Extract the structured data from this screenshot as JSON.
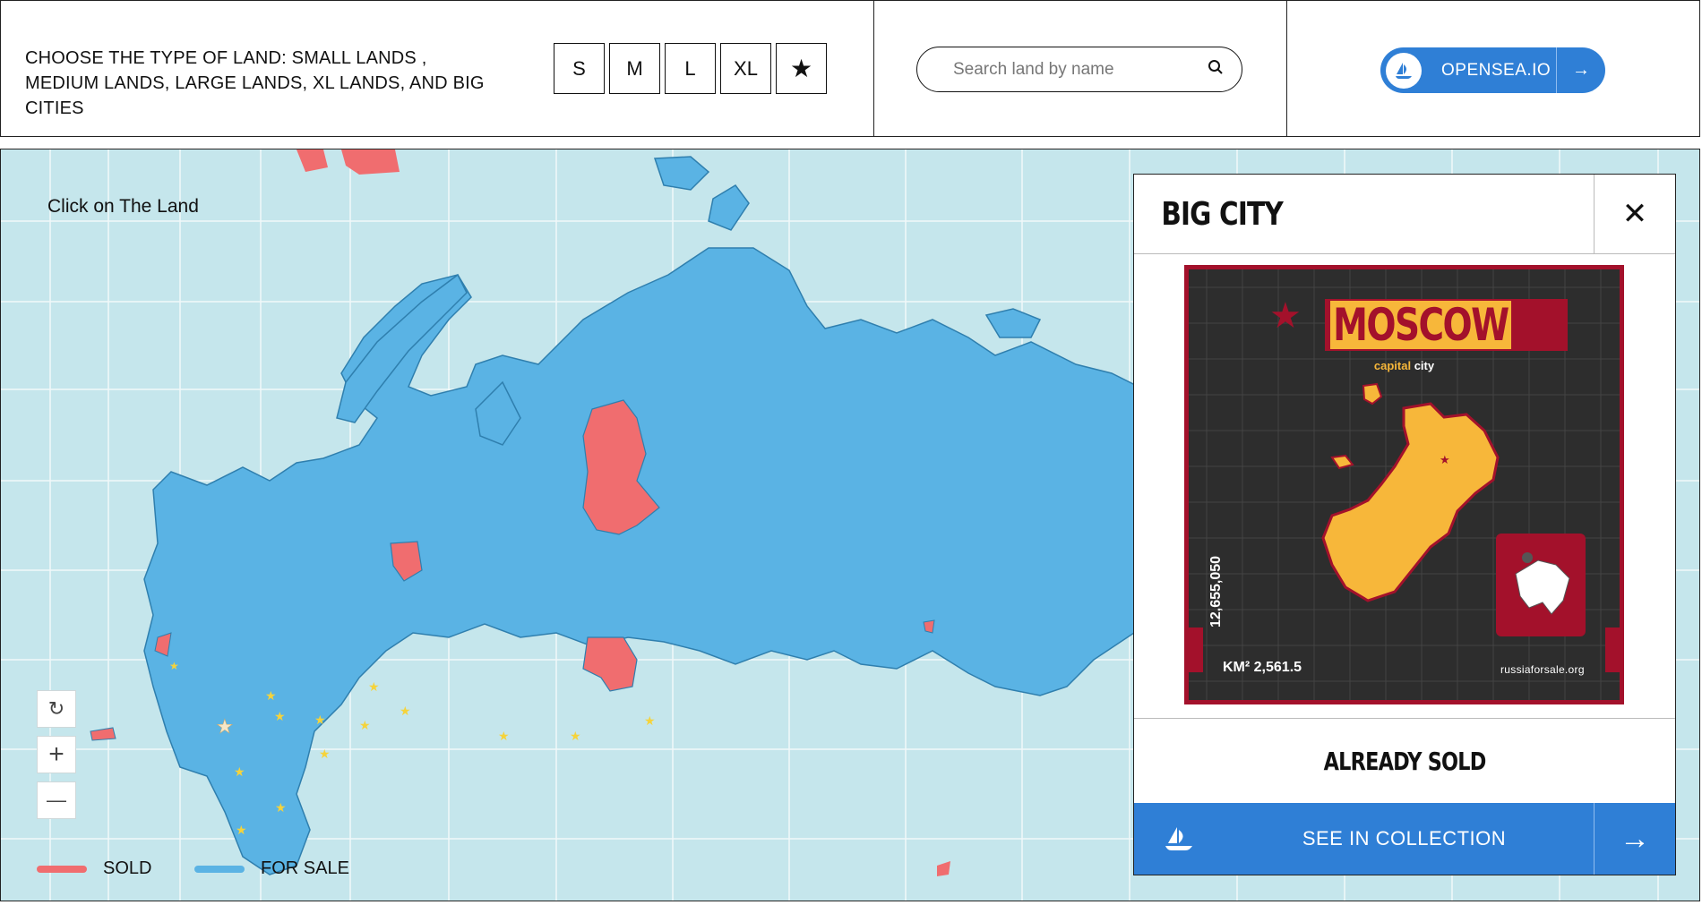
{
  "header": {
    "choose_text": "CHOOSE THE TYPE OF LAND: SMALL LANDS , MEDIUM LANDS, LARGE LANDS, XL LANDS, AND BIG CITIES",
    "type_buttons": [
      "S",
      "M",
      "L",
      "XL",
      "★"
    ],
    "search_placeholder": "Search land by name",
    "opensea_label": "OPENSEA.IO",
    "opensea_arrow": "→"
  },
  "map": {
    "hint": "Click on The Land",
    "controls": {
      "refresh": "↻",
      "zoom_in": "+",
      "zoom_out": "—"
    },
    "legend": [
      {
        "label": "SOLD",
        "color": "#f06d6f"
      },
      {
        "label": "FOR SALE",
        "color": "#5ab3e4"
      }
    ],
    "colors": {
      "water": "#c5e6ec",
      "land": "#5ab3e4",
      "sold": "#f06d6f",
      "star": "#f5d33b"
    }
  },
  "panel": {
    "title": "BIG CITY",
    "close": "✕",
    "card": {
      "city": "MOSCOW",
      "subtitle_a": "capital",
      "subtitle_b": "city",
      "population": "12,655,050",
      "area": "KM² 2,561.5",
      "site": "russiaforsale.org"
    },
    "status": "ALREADY SOLD",
    "collection_label": "SEE IN COLLECTION",
    "collection_arrow": "→"
  }
}
